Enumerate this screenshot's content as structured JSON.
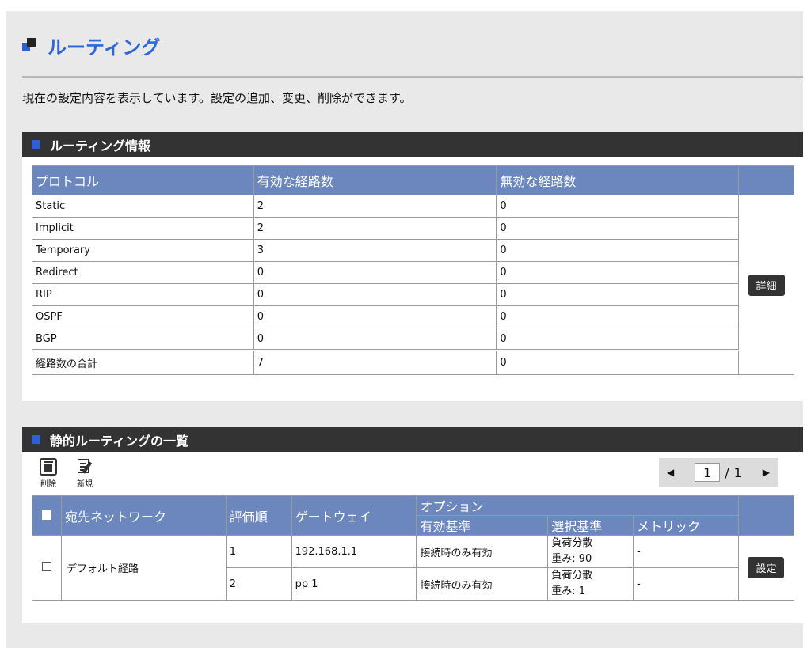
{
  "page": {
    "title": "ルーティング",
    "description": "現在の設定内容を表示しています。設定の追加、変更、削除ができます。"
  },
  "routing_info": {
    "heading": "ルーティング情報",
    "columns": [
      "プロトコル",
      "有効な経路数",
      "無効な経路数"
    ],
    "rows": [
      [
        "Static",
        "2",
        "0"
      ],
      [
        "Implicit",
        "2",
        "0"
      ],
      [
        "Temporary",
        "3",
        "0"
      ],
      [
        "Redirect",
        "0",
        "0"
      ],
      [
        "RIP",
        "0",
        "0"
      ],
      [
        "OSPF",
        "0",
        "0"
      ],
      [
        "BGP",
        "0",
        "0"
      ]
    ],
    "total": [
      "経路数の合計",
      "7",
      "0"
    ],
    "detail_label": "詳細"
  },
  "static_list": {
    "heading": "静的ルーティングの一覧",
    "toolbar": {
      "delete_label": "削除",
      "new_label": "新規"
    },
    "pager": {
      "current": "1",
      "separator": "/",
      "total": "1",
      "prev": "◀",
      "next": "▶"
    },
    "columns": {
      "dest": "宛先ネットワーク",
      "order": "評価順",
      "gateway": "ゲートウェイ",
      "option": "オプション",
      "valid_basis": "有効基準",
      "select_basis": "選択基準",
      "metric": "メトリック"
    },
    "entry": {
      "dest": "デフォルト経路",
      "gateways": [
        {
          "order": "1",
          "gateway": "192.168.1.1",
          "valid": "接続時のみ有効",
          "select_line1": "負荷分散",
          "select_line2": "重み: 90",
          "metric": "-"
        },
        {
          "order": "2",
          "gateway": "pp 1",
          "valid": "接続時のみ有効",
          "select_line1": "負荷分散",
          "select_line2": "重み: 1",
          "metric": "-"
        }
      ],
      "settings_label": "設定"
    }
  }
}
